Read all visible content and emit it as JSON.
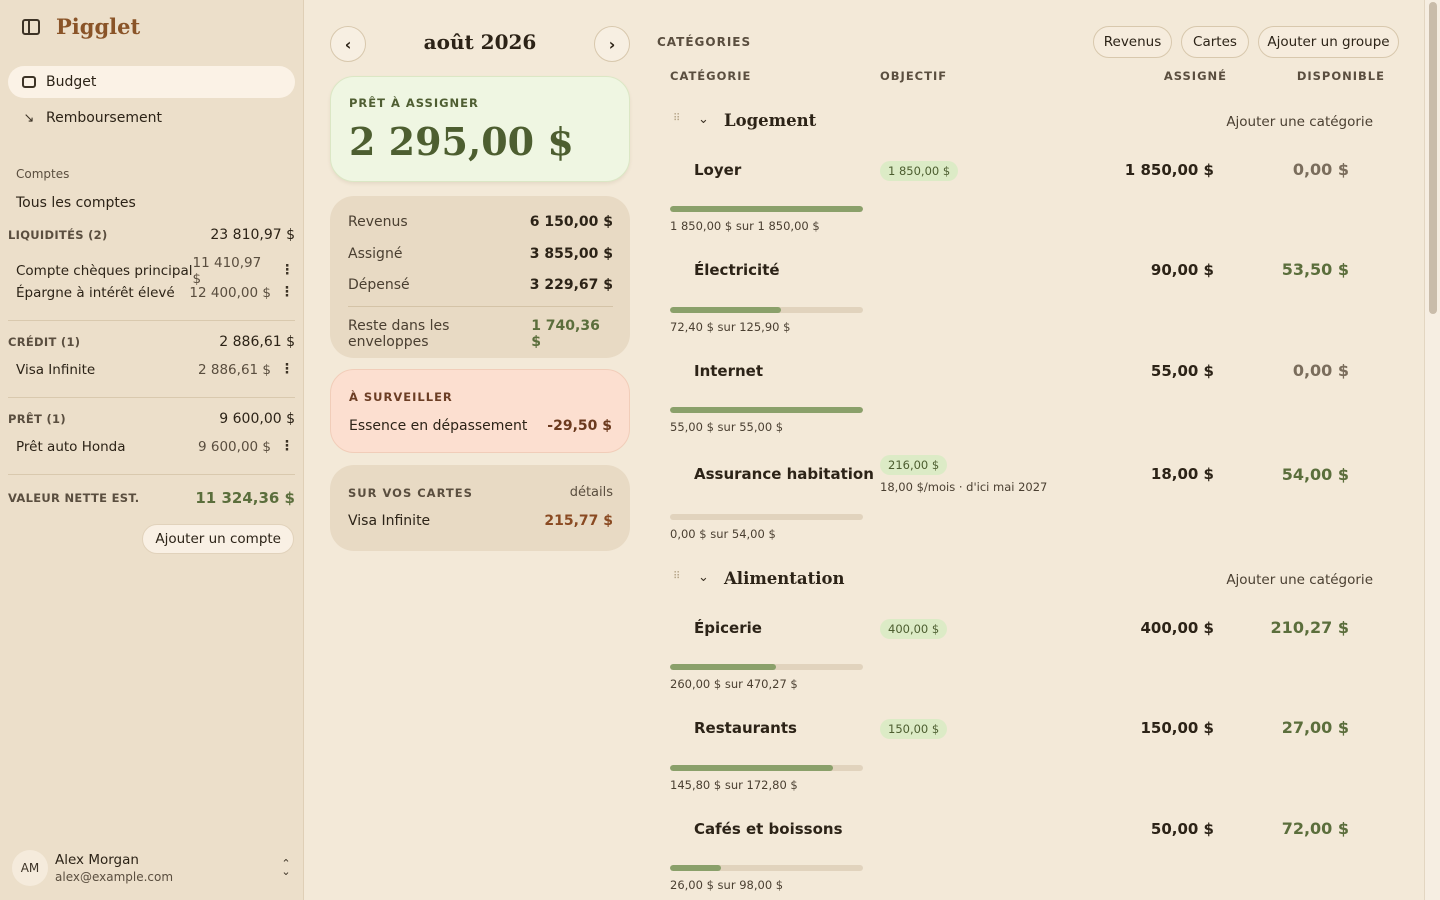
{
  "app": {
    "name": "Pigglet"
  },
  "nav": {
    "budget": "Budget",
    "remboursement": "Remboursement"
  },
  "accounts": {
    "heading": "Comptes",
    "all": "Tous les comptes",
    "liquidites": {
      "label": "LIQUIDITÉS (2)",
      "total": "23 810,97 $",
      "items": [
        {
          "name": "Compte chèques principal",
          "amount": "11 410,97 $"
        },
        {
          "name": "Épargne à intérêt élevé",
          "amount": "12 400,00 $"
        }
      ]
    },
    "credit": {
      "label": "CRÉDIT (1)",
      "total": "2 886,61 $",
      "items": [
        {
          "name": "Visa Infinite",
          "amount": "2 886,61 $"
        }
      ]
    },
    "pret": {
      "label": "PRÊT (1)",
      "total": "9 600,00 $",
      "items": [
        {
          "name": "Prêt auto Honda",
          "amount": "9 600,00 $"
        }
      ]
    },
    "networth": {
      "label": "VALEUR NETTE EST.",
      "value": "11 324,36 $"
    },
    "add_button": "Ajouter un compte"
  },
  "user": {
    "initials": "AM",
    "name": "Alex Morgan",
    "email": "alex@example.com"
  },
  "month": {
    "label": "août 2026"
  },
  "ready": {
    "label": "PRÊT À ASSIGNER",
    "amount": "2 295,00 $"
  },
  "summary": {
    "rows": [
      {
        "label": "Revenus",
        "value": "6 150,00 $"
      },
      {
        "label": "Assigné",
        "value": "3 855,00 $"
      },
      {
        "label": "Dépensé",
        "value": "3 229,67 $"
      },
      {
        "label": "Reste dans les enveloppes",
        "value": "1 740,36 $"
      }
    ]
  },
  "watch": {
    "label": "À SURVEILLER",
    "item": "Essence en dépassement",
    "value": "-29,50 $"
  },
  "cards": {
    "label": "SUR VOS CARTES",
    "details": "détails",
    "item": "Visa Infinite",
    "value": "215,77 $"
  },
  "categories": {
    "title": "CATÉGORIES",
    "buttons": {
      "revenus": "Revenus",
      "cartes": "Cartes",
      "add_group": "Ajouter un groupe"
    },
    "columns": {
      "categorie": "CATÉGORIE",
      "objectif": "OBJECTIF",
      "assigne": "ASSIGNÉ",
      "disponible": "DISPONIBLE"
    },
    "add_category": "Ajouter une catégorie",
    "groups": [
      {
        "name": "Logement",
        "items": [
          {
            "name": "Loyer",
            "goal": "1 850,00 $",
            "assigned": "1 850,00 $",
            "available": "0,00 $",
            "progress": 1.0,
            "progress_text": "1 850,00 $ sur 1 850,00 $"
          },
          {
            "name": "Électricité",
            "assigned": "90,00 $",
            "available": "53,50 $",
            "progress": 0.575,
            "progress_text": "72,40 $ sur 125,90 $"
          },
          {
            "name": "Internet",
            "assigned": "55,00 $",
            "available": "0,00 $",
            "progress": 1.0,
            "progress_text": "55,00 $ sur 55,00 $"
          },
          {
            "name": "Assurance habitation",
            "goal": "216,00 $",
            "goal_sub": "18,00 $/mois · d'ici mai 2027",
            "assigned": "18,00 $",
            "available": "54,00 $",
            "progress": 0.0,
            "progress_text": "0,00 $ sur 54,00 $"
          }
        ]
      },
      {
        "name": "Alimentation",
        "items": [
          {
            "name": "Épicerie",
            "goal": "400,00 $",
            "assigned": "400,00 $",
            "available": "210,27 $",
            "progress": 0.55,
            "progress_text": "260,00 $ sur 470,27 $"
          },
          {
            "name": "Restaurants",
            "goal": "150,00 $",
            "assigned": "150,00 $",
            "available": "27,00 $",
            "progress": 0.843,
            "progress_text": "145,80 $ sur 172,80 $"
          },
          {
            "name": "Cafés et boissons",
            "assigned": "50,00 $",
            "available": "72,00 $",
            "progress": 0.265,
            "progress_text": "26,00 $ sur 98,00 $"
          }
        ]
      }
    ]
  }
}
